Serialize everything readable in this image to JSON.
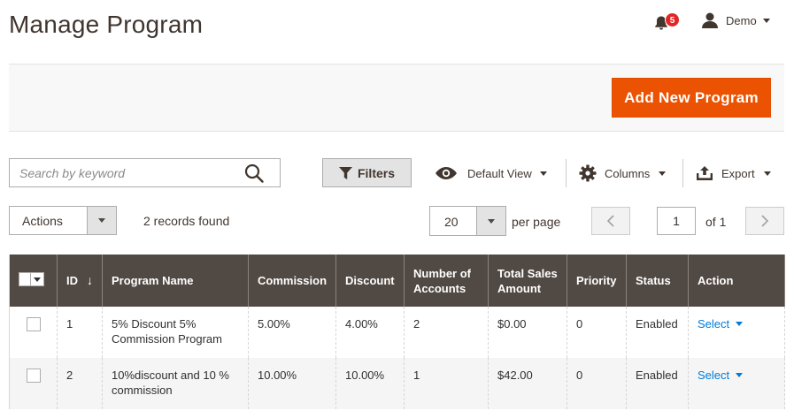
{
  "page": {
    "title": "Manage Program"
  },
  "header": {
    "notifications_count": "5",
    "user_name": "Demo"
  },
  "action_bar": {
    "add_button_label": "Add New Program"
  },
  "toolbar": {
    "search_placeholder": "Search by keyword",
    "filters_label": "Filters",
    "view_label": "Default View",
    "columns_label": "Columns",
    "export_label": "Export",
    "actions_label": "Actions",
    "records_found": "2 records found",
    "per_page_value": "20",
    "per_page_label": "per page",
    "current_page": "1",
    "of_pages": "of 1"
  },
  "grid": {
    "headers": {
      "id": "ID",
      "sort_indicator": "↓",
      "program_name": "Program Name",
      "commission": "Commission",
      "discount": "Discount",
      "accounts_line1": "Number of",
      "accounts_line2": "Accounts",
      "sales_line1": "Total Sales",
      "sales_line2": "Amount",
      "priority": "Priority",
      "status": "Status",
      "action": "Action"
    },
    "rows": [
      {
        "id": "1",
        "program_name_line1": "5% Discount 5%",
        "program_name_line2": "Commission Program",
        "commission": "5.00%",
        "discount": "4.00%",
        "accounts": "2",
        "sales": "$0.00",
        "priority": "0",
        "status": "Enabled",
        "action": "Select"
      },
      {
        "id": "2",
        "program_name_line1": "10%discount and 10 %",
        "program_name_line2": "commission",
        "commission": "10.00%",
        "discount": "10.00%",
        "accounts": "1",
        "sales": "$42.00",
        "priority": "0",
        "status": "Enabled",
        "action": "Select"
      }
    ]
  },
  "colors": {
    "accent": "#eb5202",
    "grid_header": "#514943",
    "link": "#007bdb",
    "badge": "#e22626"
  }
}
